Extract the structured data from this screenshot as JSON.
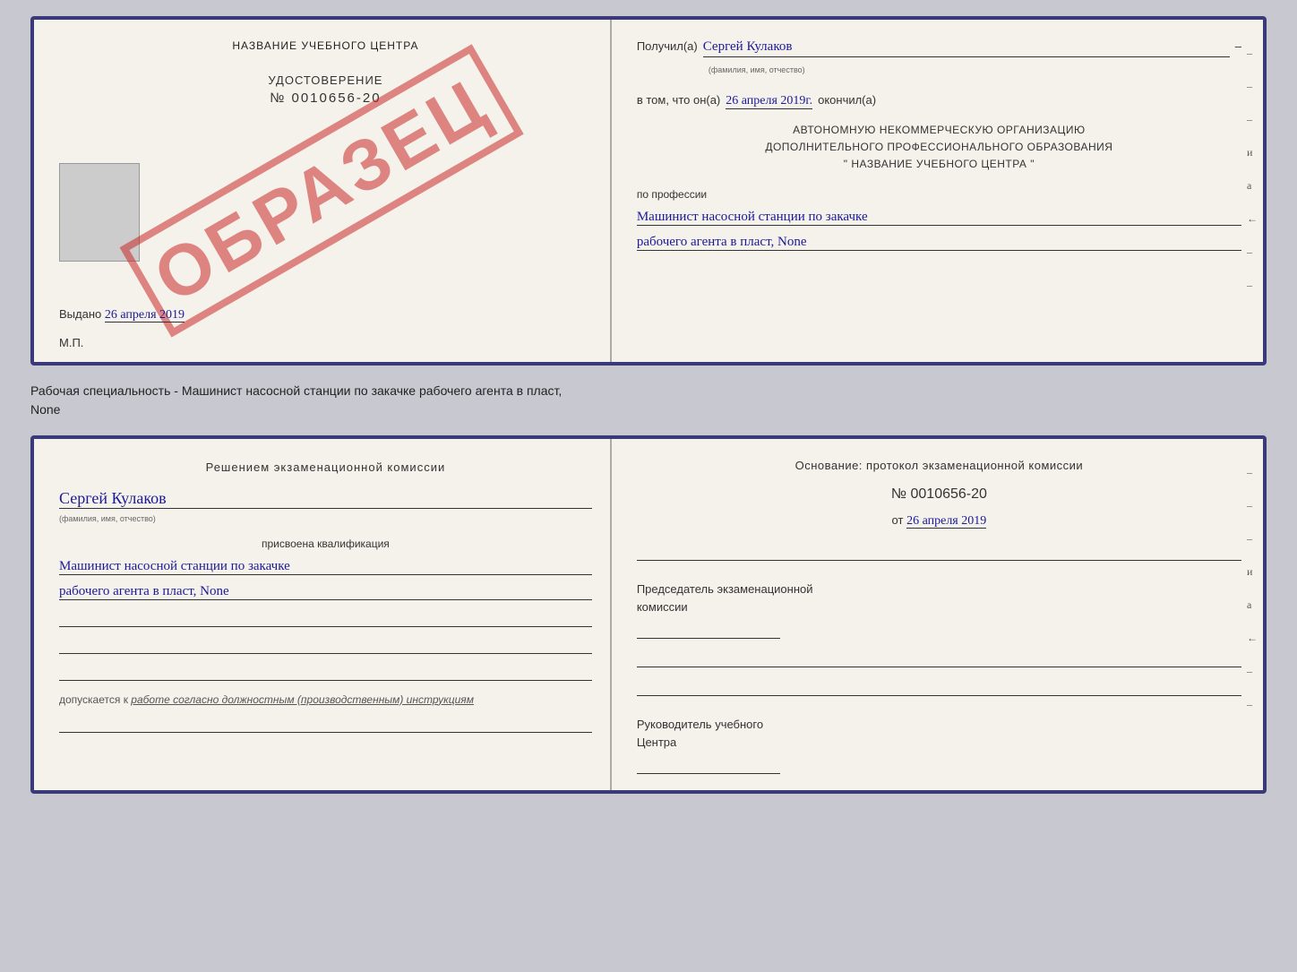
{
  "doc_top": {
    "left": {
      "title": "НАЗВАНИЕ УЧЕБНОГО ЦЕНТРА",
      "cert_label": "УДОСТОВЕРЕНИЕ",
      "cert_number": "№ 0010656-20",
      "stamp": "ОБРАЗЕЦ",
      "issued_text": "Выдано",
      "issued_date": "26 апреля 2019",
      "mp_label": "М.П."
    },
    "right": {
      "received_label": "Получил(а)",
      "received_name": "Сергей Кулаков",
      "received_sub": "(фамилия, имя, отчество)",
      "in_that_label": "в том, что он(а)",
      "date_value": "26 апреля 2019г.",
      "finished_label": "окончил(а)",
      "org_line1": "АВТОНОМНУЮ НЕКОММЕРЧЕСКУЮ ОРГАНИЗАЦИЮ",
      "org_line2": "ДОПОЛНИТЕЛЬНОГО ПРОФЕССИОНАЛЬНОГО ОБРАЗОВАНИЯ",
      "org_line3": "\"  НАЗВАНИЕ УЧЕБНОГО ЦЕНТРА  \"",
      "prof_label": "по профессии",
      "prof_line1": "Машинист насосной станции по закачке",
      "prof_line2": "рабочего агента в пласт, None",
      "side_marks": [
        "-",
        "-",
        "-",
        "и",
        "а",
        "←",
        "-",
        "-",
        "-",
        "-"
      ]
    }
  },
  "middle": {
    "text_line1": "Рабочая специальность - Машинист насосной станции по закачке рабочего агента в пласт,",
    "text_line2": "None"
  },
  "doc_bottom": {
    "left": {
      "decision_text": "Решением  экзаменационной  комиссии",
      "name_value": "Сергей Кулаков",
      "name_sub": "(фамилия, имя, отчество)",
      "assigned_label": "присвоена квалификация",
      "qualif_line1": "Машинист насосной станции по закачке",
      "qualif_line2": "рабочего агента в пласт, None",
      "допуск_prefix": "допускается к",
      "допуск_value": "работе согласно должностным (производственным) инструкциям"
    },
    "right": {
      "osnov_text": "Основание: протокол экзаменационной  комиссии",
      "proto_number": "№  0010656-20",
      "proto_from": "от",
      "proto_date": "26 апреля 2019",
      "chairman_label1": "Председатель экзаменационной",
      "chairman_label2": "комиссии",
      "head_label1": "Руководитель учебного",
      "head_label2": "Центра",
      "side_marks": [
        "-",
        "-",
        "-",
        "и",
        "а",
        "←",
        "-",
        "-",
        "-",
        "-"
      ]
    }
  }
}
